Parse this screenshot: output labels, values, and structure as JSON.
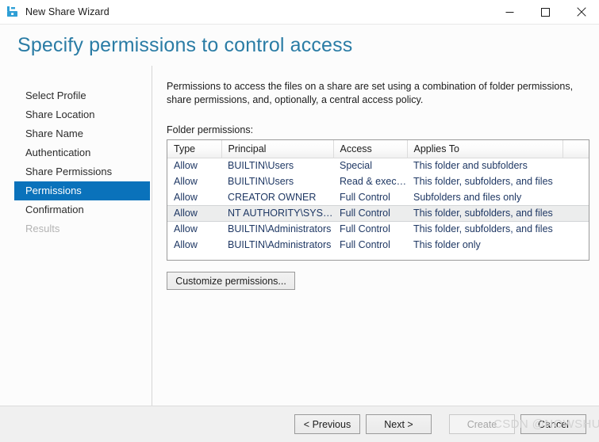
{
  "window": {
    "title": "New Share Wizard",
    "icon": "share-wizard-icon",
    "controls": {
      "minimize": "minimize-icon",
      "maximize": "maximize-icon",
      "close": "close-icon"
    }
  },
  "header": {
    "title": "Specify permissions to control access",
    "accent_color": "#2a7ca5"
  },
  "sidebar": {
    "selected_color": "#0a72bb",
    "items": [
      {
        "label": "Select Profile",
        "state": "normal"
      },
      {
        "label": "Share Location",
        "state": "normal"
      },
      {
        "label": "Share Name",
        "state": "normal"
      },
      {
        "label": "Authentication",
        "state": "normal"
      },
      {
        "label": "Share Permissions",
        "state": "normal"
      },
      {
        "label": "Permissions",
        "state": "selected"
      },
      {
        "label": "Confirmation",
        "state": "normal"
      },
      {
        "label": "Results",
        "state": "disabled"
      }
    ]
  },
  "content": {
    "intro": "Permissions to access the files on a share are set using a combination of folder permissions, share permissions, and, optionally, a central access policy.",
    "folder_permissions_label": "Folder permissions:",
    "table": {
      "columns": [
        "Type",
        "Principal",
        "Access",
        "Applies To",
        ""
      ],
      "selected_row_index": 3,
      "rows": [
        {
          "type": "Allow",
          "principal": "BUILTIN\\Users",
          "access": "Special",
          "applies_to": "This folder and subfolders"
        },
        {
          "type": "Allow",
          "principal": "BUILTIN\\Users",
          "access": "Read & execu...",
          "applies_to": "This folder, subfolders, and files"
        },
        {
          "type": "Allow",
          "principal": "CREATOR OWNER",
          "access": "Full Control",
          "applies_to": "Subfolders and files only"
        },
        {
          "type": "Allow",
          "principal": "NT AUTHORITY\\SYSTEM",
          "access": "Full Control",
          "applies_to": "This folder, subfolders, and files"
        },
        {
          "type": "Allow",
          "principal": "BUILTIN\\Administrators",
          "access": "Full Control",
          "applies_to": "This folder, subfolders, and files"
        },
        {
          "type": "Allow",
          "principal": "BUILTIN\\Administrators",
          "access": "Full Control",
          "applies_to": "This folder only"
        }
      ]
    },
    "customize_button": "Customize permissions..."
  },
  "footer": {
    "previous": "< Previous",
    "next": "Next >",
    "create": "Create",
    "cancel": "Cancel",
    "create_disabled": true
  },
  "watermark": "CSDN @NOWSHUT"
}
